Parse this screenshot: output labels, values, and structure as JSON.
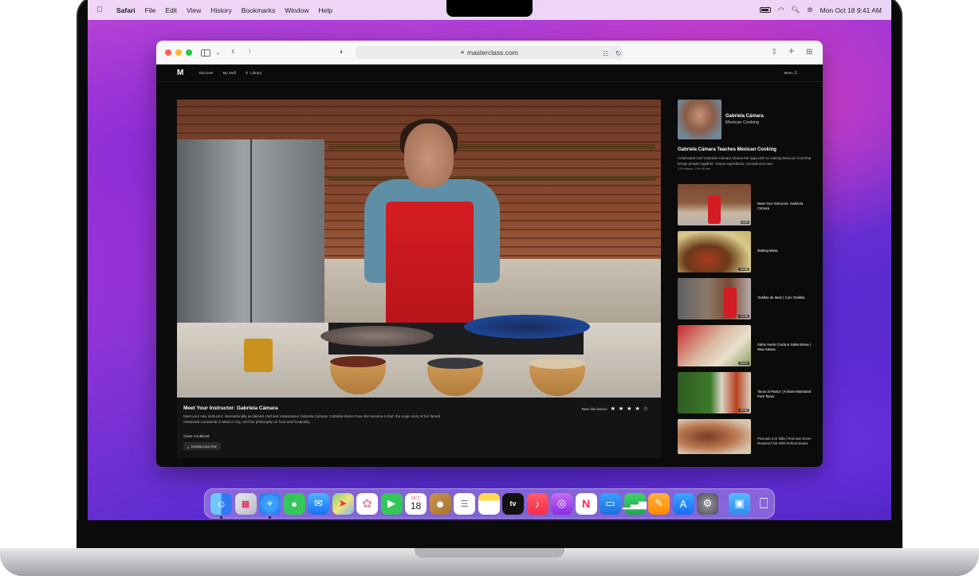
{
  "menubar": {
    "app_name": "Safari",
    "items": [
      "File",
      "Edit",
      "View",
      "History",
      "Bookmarks",
      "Window",
      "Help"
    ],
    "datetime": "Mon Oct 18  9:41 AM"
  },
  "browser": {
    "url": "masterclass.com"
  },
  "site": {
    "nav": {
      "discover": "Discover",
      "my_stuff": "My Stuff",
      "library": "Library",
      "menu": "Menu"
    },
    "lesson": {
      "title": "Meet Your Instructor: Gabriela Cámara",
      "description": "Meet your new instructor: internationally acclaimed chef and restaurateur Gabriela Cámara. Gabriela shares how she became a chef, the origin story of her famed restaurant Contramar in Mexico City, and her philosophy on food and hospitality.",
      "rate_label": "Rate this lesson",
      "rating": 4,
      "cookbook_label": "Class Cookbook",
      "download_label": "DOWNLOAD PDF"
    },
    "instructor": {
      "name": "Gabriela Cámara",
      "category": "Mexican Cooking"
    },
    "course": {
      "title": "Gabriela Cámara Teaches Mexican Cooking",
      "description": "Celebrated chef Gabriela Cámara shares her approach to making Mexican food that brings people together: simple ingredients, exceptional care.",
      "meta": "173 videos • 3 hr 26 min"
    },
    "lessons": [
      {
        "title": "Meet Your Instructor: Gabriela Cámara",
        "duration": "4:09"
      },
      {
        "title": "Making Masa",
        "duration": "16:36"
      },
      {
        "title": "Tortillas de Maíz | Corn Tortillas",
        "duration": "14:38"
      },
      {
        "title": "Salsa Verde Cruda & Salsa Brava | Raw Salsas",
        "duration": "14:21"
      },
      {
        "title": "Tacos al Pastor | Achiote Marinated Pork Tacos",
        "duration": "22:02"
      },
      {
        "title": "Pescado a la Talla | Red and Green Roasted Fish With Refried Beans",
        "duration": ""
      }
    ]
  },
  "dock": {
    "calendar_month": "OCT",
    "calendar_day": "18",
    "tv_label": "tv"
  },
  "colors": {
    "accent_red": "#d41d22",
    "page_bg": "#0b0b0c"
  }
}
